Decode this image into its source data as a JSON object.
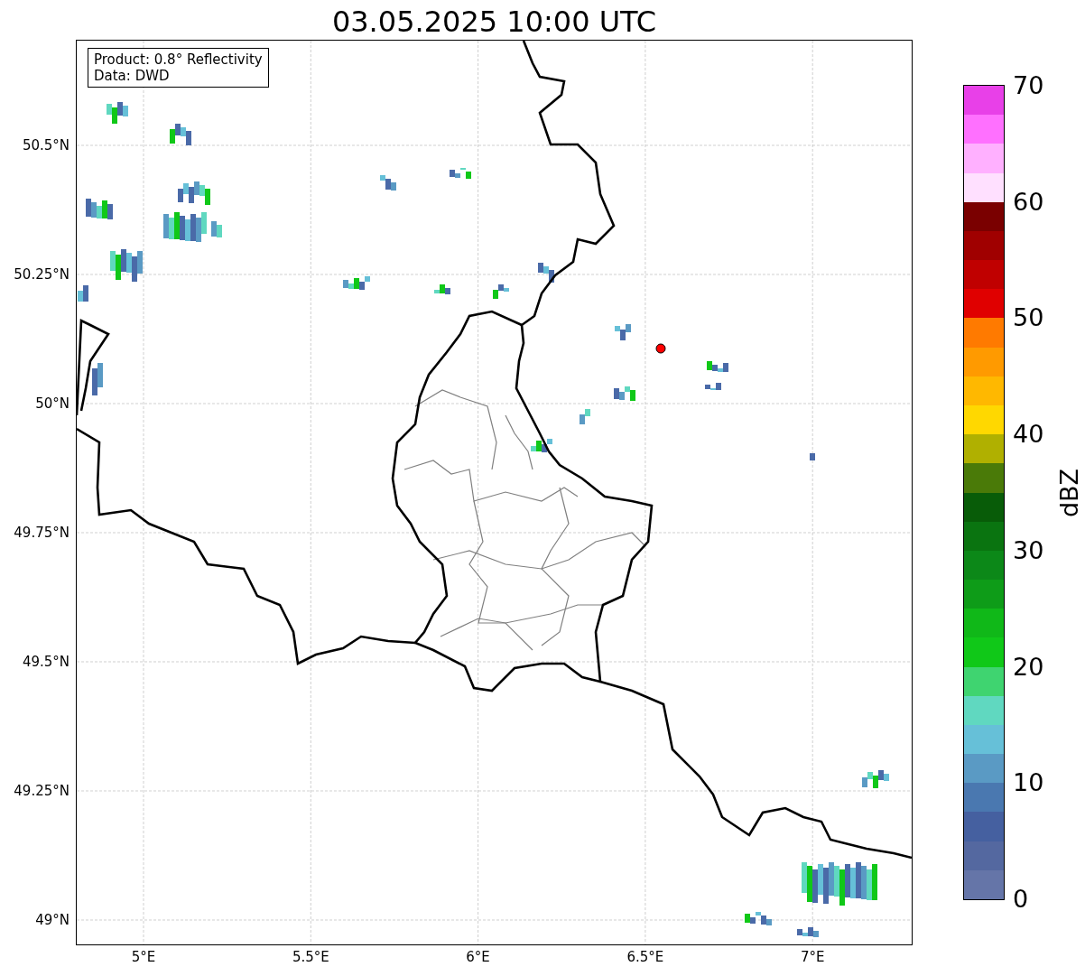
{
  "title": "03.05.2025 10:00 UTC",
  "legend_box": {
    "lines": [
      "Product: 0.8° Reflectivity",
      "Data: DWD"
    ]
  },
  "map": {
    "lat_ticks": [
      "50.5°N",
      "50.25°N",
      "50°N",
      "49.75°N",
      "49.5°N",
      "49.25°N",
      "49°N"
    ],
    "lon_ticks": [
      "5°E",
      "5.5°E",
      "6°E",
      "6.5°E",
      "7°E"
    ]
  },
  "colorbar": {
    "label": "dBZ",
    "ticks": [
      "70",
      "60",
      "50",
      "40",
      "30",
      "20",
      "10",
      "0"
    ],
    "bands": [
      {
        "color": "#6575a8"
      },
      {
        "color": "#5468a0"
      },
      {
        "color": "#4560a0"
      },
      {
        "color": "#4a78b0"
      },
      {
        "color": "#5a9ac4"
      },
      {
        "color": "#66c0d8"
      },
      {
        "color": "#60d8c0"
      },
      {
        "color": "#3fd470"
      },
      {
        "color": "#10c818"
      },
      {
        "color": "#10b818"
      },
      {
        "color": "#0e9c18"
      },
      {
        "color": "#0c8818"
      },
      {
        "color": "#0a7410"
      },
      {
        "color": "#085c08"
      },
      {
        "color": "#4a7a08"
      },
      {
        "color": "#b0b000"
      },
      {
        "color": "#ffd800"
      },
      {
        "color": "#ffb800"
      },
      {
        "color": "#ff9a00"
      },
      {
        "color": "#ff7a00"
      },
      {
        "color": "#e00000"
      },
      {
        "color": "#c00000"
      },
      {
        "color": "#a00000"
      },
      {
        "color": "#7a0000"
      },
      {
        "color": "#ffe0ff"
      },
      {
        "color": "#ffb0ff"
      },
      {
        "color": "#ff70ff"
      },
      {
        "color": "#e840e8"
      }
    ]
  }
}
